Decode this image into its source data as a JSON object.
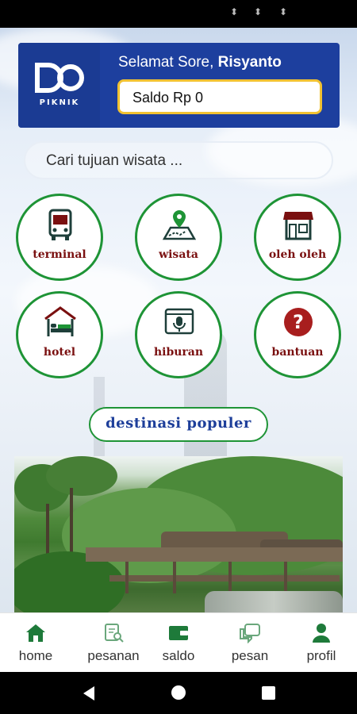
{
  "header": {
    "logo_text": "PIKNIK",
    "greeting_prefix": "Selamat Sore, ",
    "user_name": "Risyanto",
    "saldo_text": "Saldo Rp 0"
  },
  "search": {
    "text": "Cari tujuan wisata ..."
  },
  "categories": [
    {
      "label": "terminal",
      "icon": "bus-icon"
    },
    {
      "label": "wisata",
      "icon": "map-pin-icon"
    },
    {
      "label": "oleh oleh",
      "icon": "shop-icon"
    },
    {
      "label": "hotel",
      "icon": "bed-icon"
    },
    {
      "label": "hiburan",
      "icon": "microphone-icon"
    },
    {
      "label": "bantuan",
      "icon": "question-icon"
    }
  ],
  "section_pill": "destinasi populer",
  "bottom_nav": [
    {
      "label": "home",
      "icon": "home-icon"
    },
    {
      "label": "pesanan",
      "icon": "order-search-icon"
    },
    {
      "label": "saldo",
      "icon": "wallet-icon"
    },
    {
      "label": "pesan",
      "icon": "chat-icon"
    },
    {
      "label": "profil",
      "icon": "person-icon"
    }
  ],
  "colors": {
    "brand_blue": "#1d3f9e",
    "accent_green": "#1e9436",
    "label_red": "#7a1010",
    "saldo_border": "#f1c232"
  }
}
